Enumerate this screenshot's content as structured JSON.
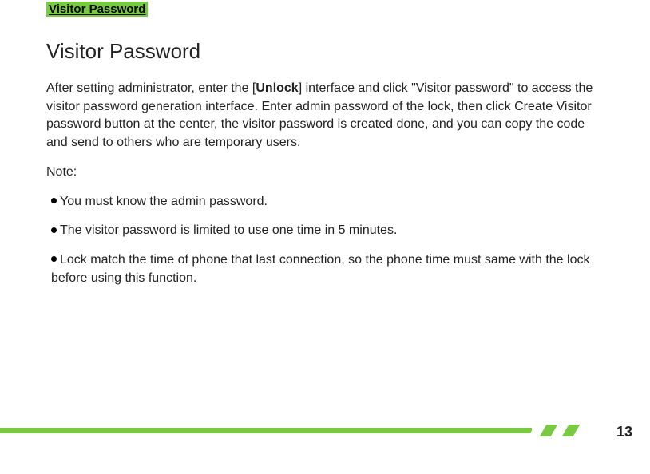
{
  "header_tag": "Visitor Password",
  "section_title": "Visitor Password",
  "intro": {
    "pre": "After setting administrator, enter the [",
    "bold": "Unlock",
    "post": "] interface and click \"Visitor password\" to access the visitor password generation interface. Enter admin password of the lock, then click Create Visitor password button at the center, the visitor password is created done, and you can copy the code and send to others who are temporary users."
  },
  "note_label": "Note:",
  "bullets": [
    "You must know the admin password.",
    "The visitor password is limited to use one time in 5 minutes.",
    "Lock match the time of phone that last connection, so the phone time must same with the lock before using this function."
  ],
  "page_number": "13"
}
